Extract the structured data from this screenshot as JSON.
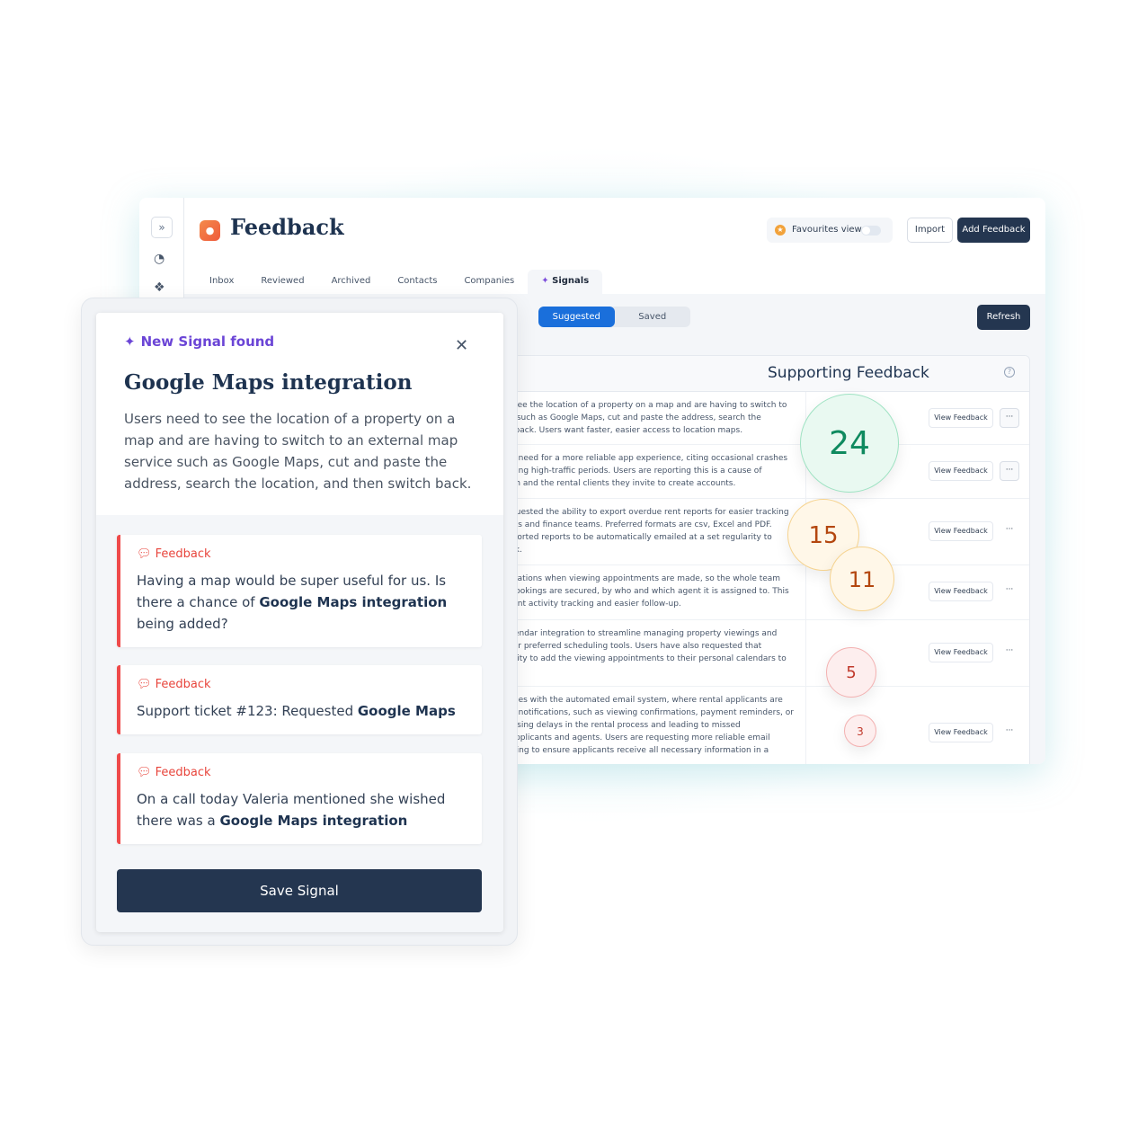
{
  "app": {
    "title": "Feedback",
    "favourites_label": "Favourites view",
    "import_label": "Import",
    "add_feedback_label": "Add Feedback"
  },
  "tabs": [
    {
      "label": "Inbox"
    },
    {
      "label": "Reviewed"
    },
    {
      "label": "Archived"
    },
    {
      "label": "Contacts"
    },
    {
      "label": "Companies"
    },
    {
      "label": "Signals",
      "active": true
    }
  ],
  "segment": {
    "suggested": "Suggested",
    "saved": "Saved",
    "selected": "Suggested"
  },
  "refresh_label": "Refresh",
  "panel": {
    "title": "Supporting Feedback",
    "view_label": "View Feedback",
    "more_label": "···",
    "rows": [
      {
        "lines": [
          "to see the location of a property on a map and are having to switch to",
          "ice such as Google Maps, cut and paste the address, search the",
          "ch back. Users want faster, easier access to location maps."
        ],
        "count": 24
      },
      {
        "lines": [
          "the need for a more reliable app experience, citing occasional crashes",
          "during high-traffic periods. Users are reporting this is a cause of",
          "hem and the rental clients they invite to create accounts."
        ],
        "count": null
      },
      {
        "lines": [
          "requested the ability to export overdue rent reports for easier tracking",
          "lords and finance teams. Preferred formats are csv, Excel and PDF.",
          "exported reports to be automatically emailed at a set regularity to",
          "task."
        ],
        "count": 15
      },
      {
        "lines": [
          "tifications when viewing appointments are made, so the whole team",
          "n bookings are secured, by who and which agent it is assigned to. This",
          "agent activity tracking and easier follow-up."
        ],
        "count": 11
      },
      {
        "lines": [
          "calendar integration to streamline managing property viewings and",
          "their preferred scheduling tools. Users have also requested that",
          "ability to add the viewing appointments to their personal calendars to"
        ],
        "count": 5
      },
      {
        "lines": [
          "issues with the automated email system, where rental applicants are",
          "ant notifications, such as viewing confirmations, payment reminders, or",
          "causing delays in the rental process and leading to missed",
          "h applicants and agents. Users are requesting more reliable email",
          "acking to ensure applicants receive all necessary information in a"
        ],
        "count": 3
      }
    ]
  },
  "signal": {
    "header": "New Signal found",
    "title": "Google Maps integration",
    "description": "Users need to see the location of a property on a map and are having to switch to an external map service such as Google Maps, cut and paste the address, search the location, and then switch back.",
    "feedback_label": "Feedback",
    "feedback": [
      {
        "pre": "Having a map would be super useful for us. Is there a chance of ",
        "bold": "Google Maps integration",
        "post": " being added?"
      },
      {
        "pre": "Support ticket #123: Requested ",
        "bold": "Google Maps",
        "post": ""
      },
      {
        "pre": "On a call today Valeria mentioned she wished there was a ",
        "bold": "Google Maps integration",
        "post": ""
      }
    ],
    "save_label": "Save Signal"
  },
  "colors": {
    "primary_dark": "#243650",
    "accent_blue": "#1a6fdb",
    "signal_purple": "#6b45d6",
    "feedback_red": "#e8453c",
    "bubble_green": "#0f8a5f",
    "bubble_orange": "#b4470f",
    "bubble_red": "#c0392b"
  }
}
